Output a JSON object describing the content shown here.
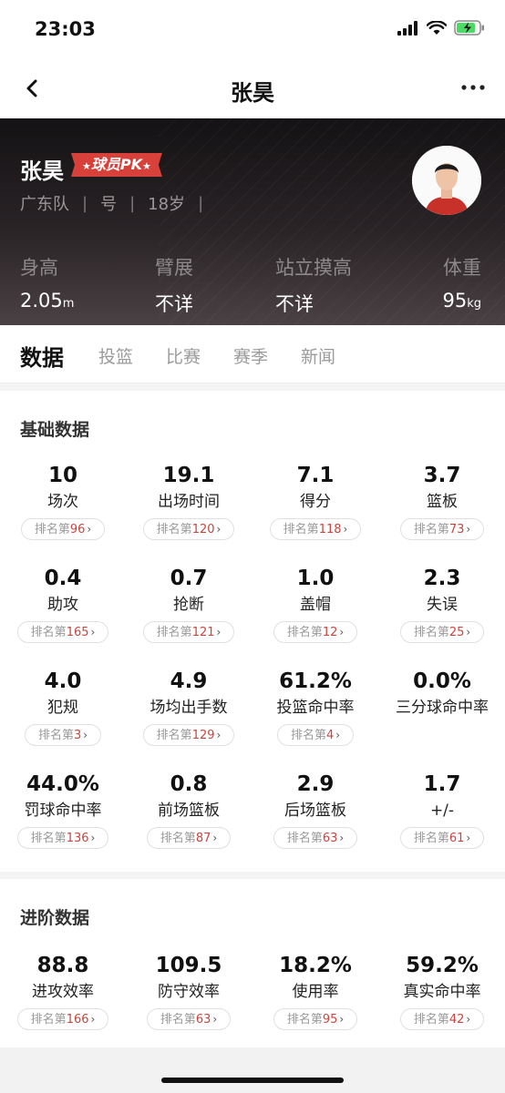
{
  "status": {
    "time": "23:03"
  },
  "nav": {
    "title": "张昊"
  },
  "player": {
    "name": "张昊",
    "pk_label": "球员PK",
    "team": "广东队",
    "number": "号",
    "age": "18岁",
    "attributes": [
      {
        "label": "身高",
        "value": "2.05",
        "unit": "m"
      },
      {
        "label": "臂展",
        "value": "不详",
        "unit": ""
      },
      {
        "label": "站立摸高",
        "value": "不详",
        "unit": ""
      },
      {
        "label": "体重",
        "value": "95",
        "unit": "kg"
      }
    ]
  },
  "tabs": [
    "数据",
    "投篮",
    "比赛",
    "赛季",
    "新闻"
  ],
  "rank_prefix": "排名第",
  "basic": {
    "title": "基础数据",
    "stats": [
      {
        "value": "10",
        "label": "场次",
        "rank": "96"
      },
      {
        "value": "19.1",
        "label": "出场时间",
        "rank": "120"
      },
      {
        "value": "7.1",
        "label": "得分",
        "rank": "118"
      },
      {
        "value": "3.7",
        "label": "篮板",
        "rank": "73"
      },
      {
        "value": "0.4",
        "label": "助攻",
        "rank": "165"
      },
      {
        "value": "0.7",
        "label": "抢断",
        "rank": "121"
      },
      {
        "value": "1.0",
        "label": "盖帽",
        "rank": "12"
      },
      {
        "value": "2.3",
        "label": "失误",
        "rank": "25"
      },
      {
        "value": "4.0",
        "label": "犯规",
        "rank": "3"
      },
      {
        "value": "4.9",
        "label": "场均出手数",
        "rank": "129"
      },
      {
        "value": "61.2%",
        "label": "投篮命中率",
        "rank": "4"
      },
      {
        "value": "0.0%",
        "label": "三分球命中率",
        "rank": ""
      },
      {
        "value": "44.0%",
        "label": "罚球命中率",
        "rank": "136"
      },
      {
        "value": "0.8",
        "label": "前场篮板",
        "rank": "87"
      },
      {
        "value": "2.9",
        "label": "后场篮板",
        "rank": "63"
      },
      {
        "value": "1.7",
        "label": "+/-",
        "rank": "61"
      }
    ]
  },
  "advanced": {
    "title": "进阶数据",
    "stats": [
      {
        "value": "88.8",
        "label": "进攻效率",
        "rank": "166"
      },
      {
        "value": "109.5",
        "label": "防守效率",
        "rank": "63"
      },
      {
        "value": "18.2%",
        "label": "使用率",
        "rank": "95"
      },
      {
        "value": "59.2%",
        "label": "真实命中率",
        "rank": "42"
      }
    ]
  }
}
